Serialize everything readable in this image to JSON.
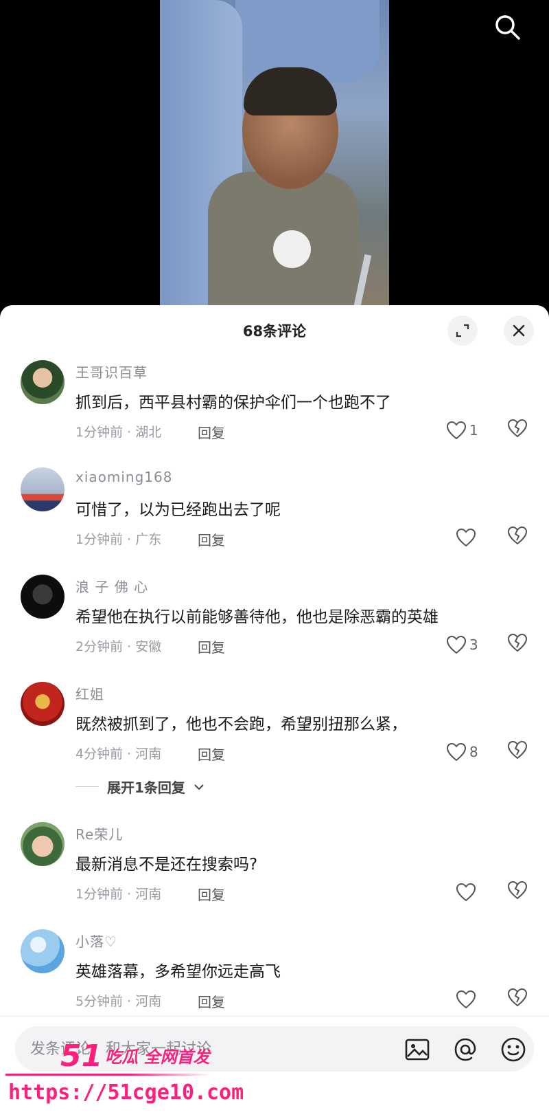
{
  "header": {
    "title": "68条评论"
  },
  "comments": [
    {
      "user": "王哥识百草",
      "text": "抓到后，西平县村霸的保护伞们一个也跑不了",
      "meta": "1分钟前 · 湖北",
      "reply": "回复",
      "likes": "1"
    },
    {
      "user": "xiaoming168",
      "text": "可惜了，以为已经跑出去了呢",
      "meta": "1分钟前 · 广东",
      "reply": "回复",
      "likes": ""
    },
    {
      "user": "浪 子 佛 心",
      "text": "希望他在执行以前能够善待他，他也是除恶霸的英雄",
      "meta": "2分钟前 · 安徽",
      "reply": "回复",
      "likes": "3"
    },
    {
      "user": "红姐",
      "text": "既然被抓到了，他也不会跑，希望别扭那么紧，",
      "meta": "4分钟前 · 河南",
      "reply": "回复",
      "likes": "8",
      "expand": "展开1条回复"
    },
    {
      "user": "Re荣儿",
      "text": "最新消息不是还在搜索吗?",
      "meta": "1分钟前 · 河南",
      "reply": "回复",
      "likes": ""
    },
    {
      "user": "小落♡",
      "text": "英雄落幕，多希望你远走高飞",
      "meta": "5分钟前 · 河南",
      "reply": "回复",
      "likes": ""
    }
  ],
  "input": {
    "placeholder": "发条评论，和大家一起讨论"
  },
  "watermark": {
    "brand_num": "51",
    "brand_tag": "吃瓜 全网首发",
    "url": "https://51cge10.com"
  },
  "colors": {
    "accent": "#ff1e7a",
    "text_primary": "#1a1a1a",
    "text_secondary": "#8c8c94"
  }
}
